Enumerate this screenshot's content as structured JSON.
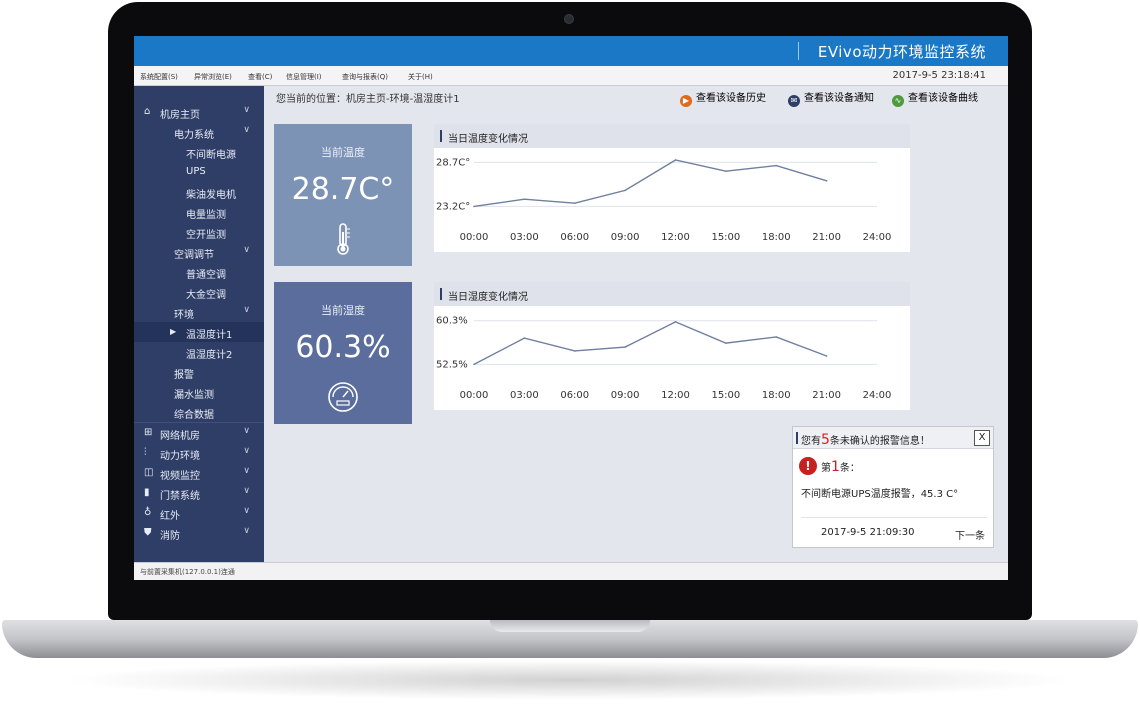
{
  "app": {
    "title": "EVivo动力环境监控系统"
  },
  "menubar": {
    "items": [
      "系统配置(S)",
      "异常浏览(E)",
      "查看(C)",
      "信息管理(I)",
      "查询与报表(Q)",
      "关于(H)"
    ],
    "datetime": "2017-9-5   23:18:41"
  },
  "sidebar": {
    "home": "机房主页",
    "power_system": "电力系统",
    "ups_power": "不间断电源",
    "ups": "UPS",
    "diesel": "柴油发电机",
    "energy": "电量监测",
    "breaker": "空开监测",
    "ac": "空调调节",
    "normal_ac": "普通空调",
    "precision_ac": "大金空调",
    "env": "环境",
    "th1": "温湿度计1",
    "th2": "温湿度计2",
    "alarm": "报警",
    "leak": "漏水监测",
    "data": "综合数据",
    "network": "网络机房",
    "power_env": "动力环境",
    "video": "视频监控",
    "door": "门禁系统",
    "ir": "红外",
    "fire": "消防"
  },
  "breadcrumb": "您当前的位置：机房主页-环境-温湿度计1",
  "actions": {
    "history": "查看该设备历史",
    "notify": "查看该设备通知",
    "curve": "查看该设备曲线"
  },
  "cards": {
    "temp_label": "当前温度",
    "temp_value": "28.7C°",
    "hum_label": "当前湿度",
    "hum_value": "60.3%"
  },
  "colors": {
    "titlebar": "#1a78c6",
    "sidebar": "#2f3e66",
    "temp_card": "#7d93b5",
    "hum_card": "#5a6d9d",
    "line": "#6f7f9f",
    "alert_red": "#c82020"
  },
  "chart_data": [
    {
      "type": "line",
      "title": "当日温度变化情况",
      "categories": [
        "00:00",
        "03:00",
        "06:00",
        "09:00",
        "12:00",
        "15:00",
        "18:00",
        "21:00",
        "24:00"
      ],
      "ytick_labels": [
        "28.7C°",
        "23.2C°"
      ],
      "ylim": [
        22.5,
        29.5
      ],
      "series": [
        {
          "x": [
            "00:00",
            "03:00",
            "06:00",
            "09:00",
            "12:00",
            "15:00",
            "18:00",
            "21:00"
          ],
          "values": [
            23.2,
            24.1,
            23.6,
            25.2,
            29.0,
            27.6,
            28.3,
            26.4
          ]
        }
      ],
      "grid": true
    },
    {
      "type": "line",
      "title": "当日湿度变化情况",
      "categories": [
        "00:00",
        "03:00",
        "06:00",
        "09:00",
        "12:00",
        "15:00",
        "18:00",
        "21:00",
        "24:00"
      ],
      "ytick_labels": [
        "60.3%",
        "52.5%"
      ],
      "ylim": [
        51.5,
        61.5
      ],
      "series": [
        {
          "x": [
            "00:00",
            "03:00",
            "06:00",
            "09:00",
            "12:00",
            "15:00",
            "18:00",
            "21:00"
          ],
          "values": [
            52.5,
            57.2,
            54.9,
            55.6,
            60.1,
            56.3,
            57.4,
            54.0
          ]
        }
      ],
      "grid": true
    }
  ],
  "alert": {
    "title_prefix": "您有",
    "count": "5",
    "title_suffix": "条未确认的报警信息！",
    "close": "X",
    "index_prefix": "第",
    "index": "1",
    "index_suffix": "条：",
    "message": "不间断电源UPS温度报警，45.3 C°",
    "time": "2017-9-5 21:09:30",
    "next": "下一条"
  },
  "statusbar": {
    "text": "与前置采集机(127.0.0.1)连通"
  }
}
